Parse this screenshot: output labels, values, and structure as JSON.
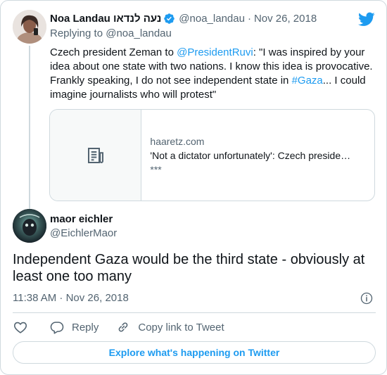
{
  "parent_tweet": {
    "author_name": "Noa Landau נעה לנדאו",
    "handle": "@noa_landau",
    "separator": "·",
    "date": "Nov 26, 2018",
    "replying_to_label": "Replying to",
    "replying_to_handle": "@noa_landau",
    "text_parts": {
      "p1": "Czech president Zeman to ",
      "mention": "@PresidentRuvi",
      "p2": ": \"I was inspired by your idea about one state with two nations. I know this idea is provocative. Frankly speaking, I do not see independent state in ",
      "hashtag": "#Gaza",
      "p3": "... I could imagine journalists who will protest\""
    },
    "link_card": {
      "domain": "haaretz.com",
      "title": "'Not a dictator unfortunately': Czech preside…",
      "description": "***",
      "thumbnail_icon": "document-icon"
    }
  },
  "main_tweet": {
    "author_name": "maor eichler",
    "handle": "@EichlerMaor",
    "text": "Independent Gaza would be the third state - obviously at least one too many",
    "timestamp": "11:38 AM · Nov 26, 2018",
    "actions": {
      "like_icon": "heart-icon",
      "reply_label": "Reply",
      "copy_label": "Copy link to Tweet"
    },
    "explore_label": "Explore what's happening on Twitter"
  },
  "colors": {
    "accent": "#1d9bf0",
    "text": "#0f1419",
    "muted": "#536471",
    "border": "#cfd9de"
  }
}
